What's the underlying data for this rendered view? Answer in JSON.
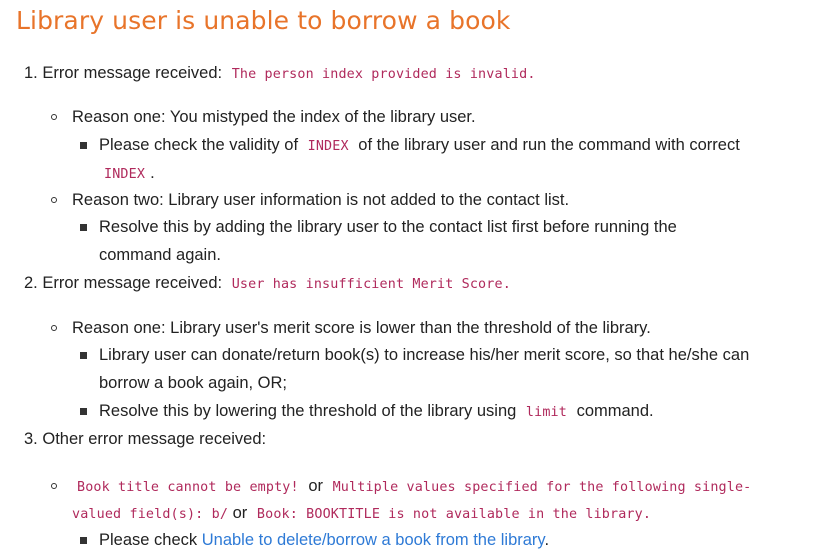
{
  "title": "Library user is unable to borrow a book",
  "item1": {
    "number": "1.",
    "lead": "Error message received:",
    "code": "The person index provided is invalid.",
    "reason1": {
      "text": "Reason one: You mistyped the index of the library user.",
      "sub_before": "Please check the validity of",
      "sub_code": "INDEX",
      "sub_after": "of the library user and run the command with correct",
      "sub_code2": "INDEX",
      "sub_end": "."
    },
    "reason2": {
      "text": "Reason two: Library user information is not added to the contact list.",
      "sub_line1": "Resolve this by adding the library user to the contact list first before running the",
      "sub_line2": "command again."
    }
  },
  "item2": {
    "number": "2.",
    "lead": "Error message received:",
    "code": "User has insufficient Merit Score.",
    "reason1": {
      "text": "Reason one: Library user's merit score is lower than the threshold of the library.",
      "sub1_line1": "Library user can donate/return book(s) to increase his/her merit score, so that he/she can",
      "sub1_line2": "borrow a book again, OR;",
      "sub2_before": "Resolve this by lowering the threshold of the library using",
      "sub2_code": "limit",
      "sub2_after": "command."
    }
  },
  "item3": {
    "number": "3.",
    "lead": "Other error message received:",
    "code1": "Book title cannot be empty!",
    "or1": "or",
    "code2a": "Multiple values specified for the following single-",
    "code2b": "valued field(s): b/",
    "or2": "or",
    "code3": "Book: BOOKTITLE is not available in the library.",
    "sub_before": "Please check",
    "sub_link": "Unable to delete/borrow a book from the library",
    "sub_end": "."
  },
  "colors": {
    "heading": "#e8742a",
    "code": "#b02a5c",
    "link": "#2e7ad6",
    "text": "#222222"
  }
}
